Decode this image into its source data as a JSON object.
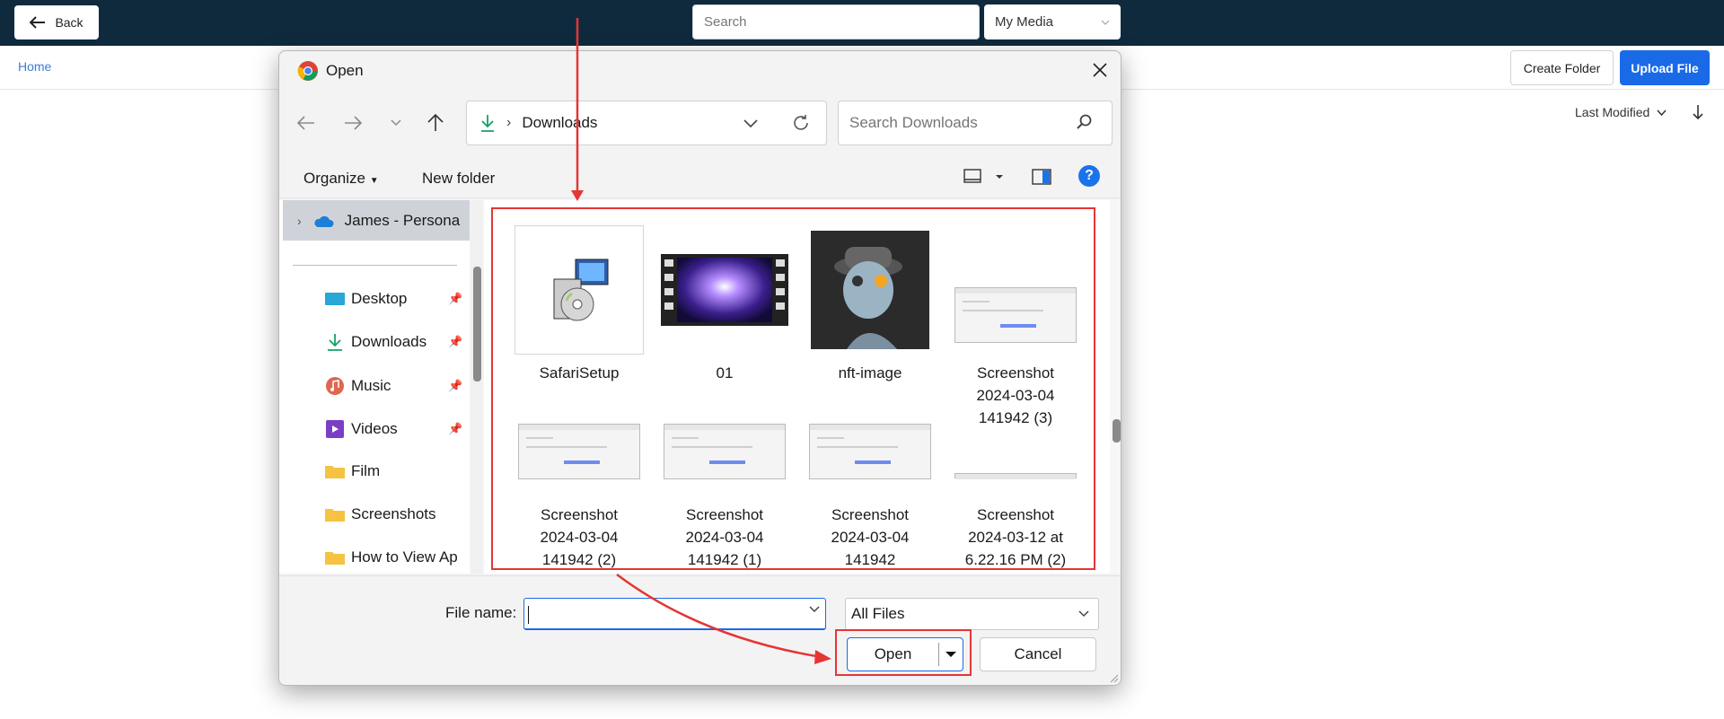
{
  "topbar": {
    "back_label": "Back",
    "search_placeholder": "Search",
    "media_select": "My Media"
  },
  "subbar": {
    "home": "Home",
    "create_folder": "Create Folder",
    "upload_file": "Upload File",
    "sort_label": "Last Modified"
  },
  "dialog": {
    "title": "Open",
    "path": "Downloads",
    "search_placeholder": "Search Downloads",
    "organize": "Organize",
    "new_folder": "New folder",
    "help": "?",
    "sidebar": {
      "top": "James - Persona",
      "items": [
        {
          "label": "Desktop",
          "icon": "desktop-icon",
          "pinned": true
        },
        {
          "label": "Downloads",
          "icon": "download-icon",
          "pinned": true
        },
        {
          "label": "Music",
          "icon": "music-icon",
          "pinned": true
        },
        {
          "label": "Videos",
          "icon": "video-icon",
          "pinned": true
        },
        {
          "label": "Film",
          "icon": "folder-icon",
          "pinned": false
        },
        {
          "label": "Screenshots",
          "icon": "folder-icon",
          "pinned": false
        },
        {
          "label": "How to View Ap",
          "icon": "folder-icon",
          "pinned": false
        }
      ]
    },
    "files": [
      {
        "lines": [
          "SafariSetup"
        ],
        "kind": "installer"
      },
      {
        "lines": [
          "01"
        ],
        "kind": "video"
      },
      {
        "lines": [
          "nft-image"
        ],
        "kind": "image"
      },
      {
        "lines": [
          "Screenshot",
          "2024-03-04",
          "141942 (3)"
        ],
        "kind": "screenshot"
      },
      {
        "lines": [
          "Screenshot",
          "2024-03-04",
          "141942 (2)"
        ],
        "kind": "screenshot"
      },
      {
        "lines": [
          "Screenshot",
          "2024-03-04",
          "141942 (1)"
        ],
        "kind": "screenshot"
      },
      {
        "lines": [
          "Screenshot",
          "2024-03-04",
          "141942"
        ],
        "kind": "screenshot"
      },
      {
        "lines": [
          "Screenshot",
          "2024-03-12 at",
          "6.22.16 PM (2)"
        ],
        "kind": "screenshot"
      }
    ],
    "file_name_label": "File name:",
    "file_name_value": "",
    "filter": "All Files",
    "open": "Open",
    "cancel": "Cancel"
  },
  "colors": {
    "topbar": "#0f2a3d",
    "accent": "#1a6ae8",
    "annotation": "#e53535"
  }
}
